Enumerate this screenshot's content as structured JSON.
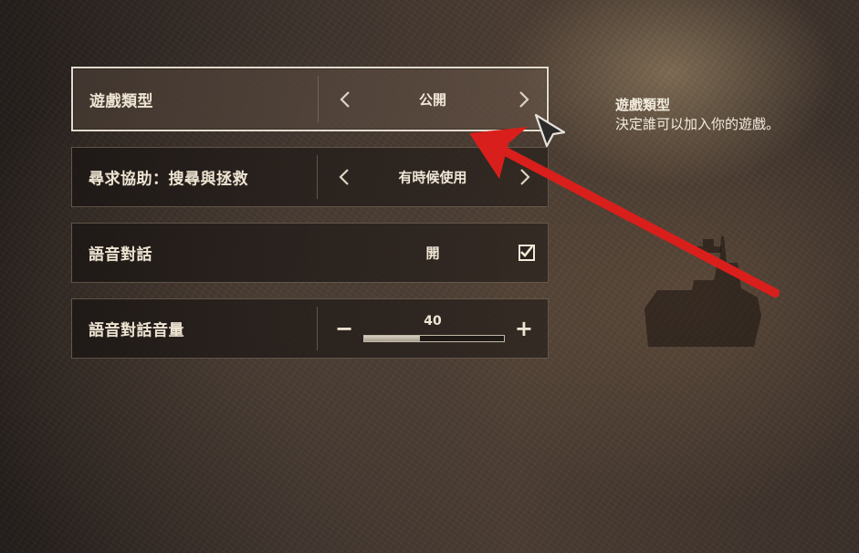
{
  "rows": [
    {
      "label": "遊戲類型",
      "value": "公開"
    },
    {
      "label": "尋求協助：搜尋與拯救",
      "value": "有時候使用"
    },
    {
      "label": "語音對話",
      "value": "開"
    },
    {
      "label": "語音對話音量",
      "value": "40"
    }
  ],
  "help": {
    "title": "遊戲類型",
    "description": "決定誰可以加入你的遊戲。"
  },
  "controls": {
    "minus": "−",
    "plus": "+",
    "checkbox_checked": true,
    "slider_fraction": 0.4
  },
  "icons": {
    "left_arrow": "chevron-left-icon",
    "right_arrow": "chevron-right-icon",
    "checkbox": "checkmark-icon",
    "cursor": "mouse-cursor-icon",
    "annotation": "red-arrow-icon"
  },
  "colors": {
    "annotation_red": "#d91f1b",
    "text": "#eee4d2",
    "active_border": "#ebe4d6"
  }
}
